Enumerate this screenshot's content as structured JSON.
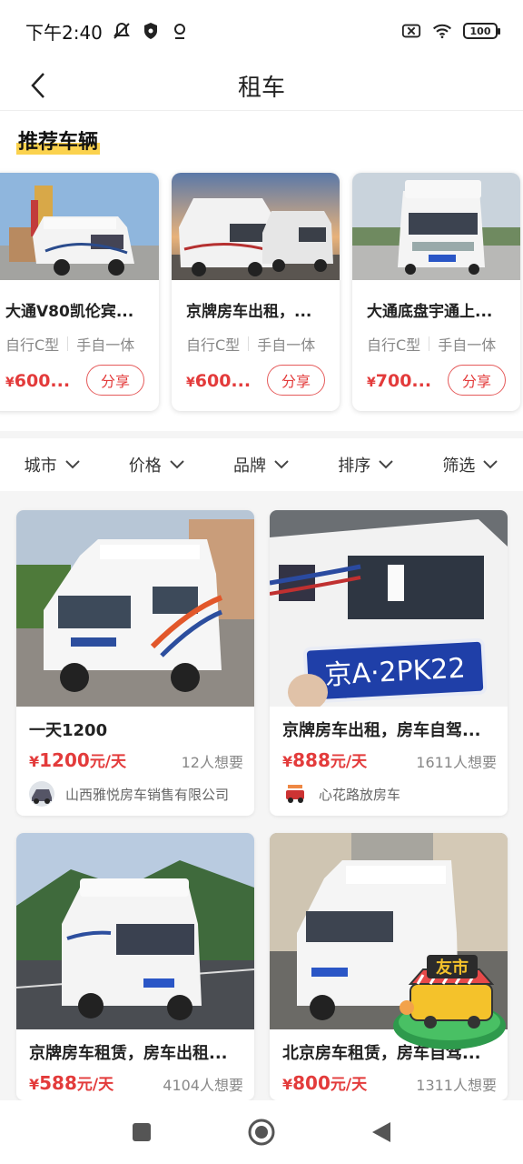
{
  "status_bar": {
    "time": "下午2:40",
    "battery": "100"
  },
  "nav": {
    "title": "租车"
  },
  "recommend": {
    "title": "推荐车辆",
    "share_label": "分享",
    "cards": [
      {
        "name": "大通V80凯伦宾...",
        "tags": [
          "自行C型",
          "手自一体"
        ],
        "price_symbol": "¥",
        "price": "600..."
      },
      {
        "name": "京牌房车出租，...",
        "tags": [
          "自行C型",
          "手自一体"
        ],
        "price_symbol": "¥",
        "price": "600..."
      },
      {
        "name": "大通底盘宇通上...",
        "tags": [
          "自行C型",
          "手自一体"
        ],
        "price_symbol": "¥",
        "price": "700..."
      }
    ]
  },
  "filters": [
    {
      "label": "城市"
    },
    {
      "label": "价格"
    },
    {
      "label": "品牌"
    },
    {
      "label": "排序"
    },
    {
      "label": "筛选"
    }
  ],
  "listings": [
    {
      "title": "一天1200",
      "price_symbol": "¥",
      "price": "1200",
      "unit": "元/天",
      "want": "12人想要",
      "seller": "山西雅悦房车销售有限公司"
    },
    {
      "title": "京牌房车出租，房车自驾...",
      "price_symbol": "¥",
      "price": "888",
      "unit": "元/天",
      "want": "1611人想要",
      "seller": "心花路放房车",
      "plate": "京A·2PK22"
    },
    {
      "title": "京牌房车租赁，房车出租...",
      "price_symbol": "¥",
      "price": "588",
      "unit": "元/天",
      "want": "4104人想要"
    },
    {
      "title": "北京房车租赁，房车自驾...",
      "price_symbol": "¥",
      "price": "800",
      "unit": "元/天",
      "want": "1311人想要"
    }
  ],
  "float_badge": {
    "label": "友市"
  },
  "colors": {
    "accent": "#e33b3b",
    "highlight": "#fbd24e"
  }
}
